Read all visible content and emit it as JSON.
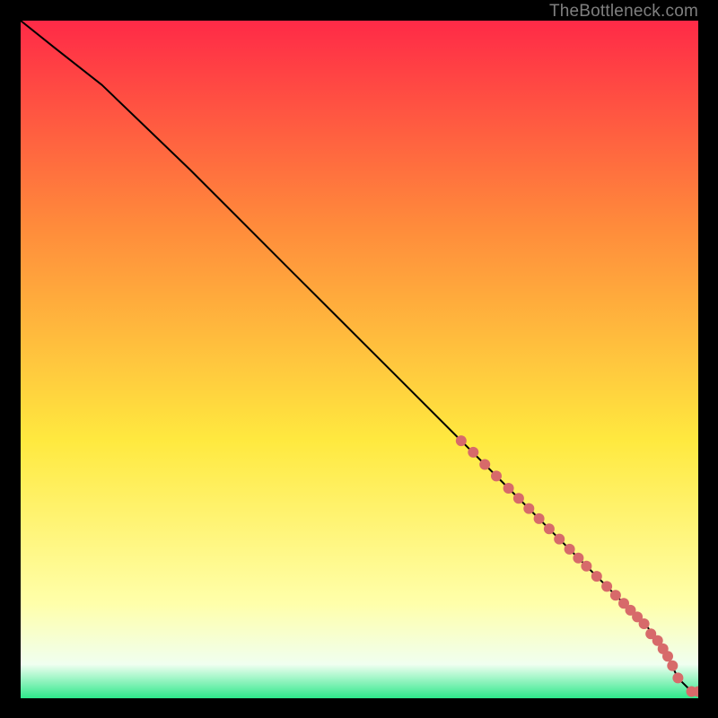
{
  "watermark": {
    "text": "TheBottleneck.com"
  },
  "chart_data": {
    "type": "line",
    "title": "",
    "xlabel": "",
    "ylabel": "",
    "xlim": [
      0,
      100
    ],
    "ylim": [
      0,
      100
    ],
    "grid": false,
    "background_gradient": {
      "top": "#ff2a47",
      "upper_mid": "#ff8a3b",
      "mid": "#ffe93f",
      "lower_mid": "#ffffaa",
      "edge": "#f0fff0",
      "bottom": "#2ee88b"
    },
    "curve": {
      "description": "Single monotone-decreasing curve from top-left corner to bottom-right, slight ease-out near the top and a kink + flat tail near the bottom right.",
      "x": [
        0,
        5,
        12,
        25,
        40,
        55,
        65,
        72,
        78,
        83,
        86.5,
        89,
        91,
        92.5,
        94,
        95.3,
        97,
        99,
        100
      ],
      "y": [
        100,
        96,
        90.5,
        78,
        63,
        48,
        38,
        31,
        25,
        20,
        16.5,
        14,
        12,
        10.5,
        8.5,
        6.5,
        3,
        1,
        1
      ]
    },
    "markers": {
      "color": "#d76a6a",
      "points": [
        {
          "x": 65.0,
          "y": 38.0
        },
        {
          "x": 66.8,
          "y": 36.3
        },
        {
          "x": 68.5,
          "y": 34.5
        },
        {
          "x": 70.2,
          "y": 32.8
        },
        {
          "x": 72.0,
          "y": 31.0
        },
        {
          "x": 73.5,
          "y": 29.5
        },
        {
          "x": 75.0,
          "y": 28.0
        },
        {
          "x": 76.5,
          "y": 26.5
        },
        {
          "x": 78.0,
          "y": 25.0
        },
        {
          "x": 79.5,
          "y": 23.5
        },
        {
          "x": 81.0,
          "y": 22.0
        },
        {
          "x": 82.3,
          "y": 20.7
        },
        {
          "x": 83.5,
          "y": 19.5
        },
        {
          "x": 85.0,
          "y": 18.0
        },
        {
          "x": 86.5,
          "y": 16.5
        },
        {
          "x": 87.8,
          "y": 15.2
        },
        {
          "x": 89.0,
          "y": 14.0
        },
        {
          "x": 90.0,
          "y": 13.0
        },
        {
          "x": 91.0,
          "y": 12.0
        },
        {
          "x": 92.0,
          "y": 11.0
        },
        {
          "x": 93.0,
          "y": 9.5
        },
        {
          "x": 94.0,
          "y": 8.5
        },
        {
          "x": 94.8,
          "y": 7.3
        },
        {
          "x": 95.5,
          "y": 6.2
        },
        {
          "x": 96.2,
          "y": 4.8
        },
        {
          "x": 97.0,
          "y": 3.0
        },
        {
          "x": 99.0,
          "y": 1.0
        },
        {
          "x": 100.0,
          "y": 1.0
        }
      ]
    }
  }
}
